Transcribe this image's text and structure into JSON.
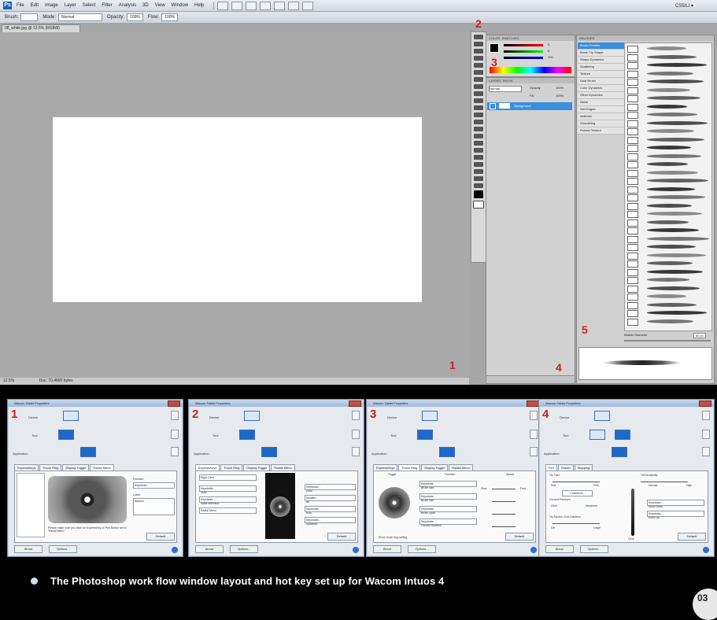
{
  "photoshop": {
    "menu": [
      "File",
      "Edit",
      "Image",
      "Layer",
      "Select",
      "Filter",
      "Analysis",
      "3D",
      "View",
      "Window",
      "Help"
    ],
    "workspace_label": "CS5/LI ▾",
    "options": {
      "brush_label": "Brush:",
      "mode_label": "Mode:",
      "mode_value": "Normal",
      "opacity_label": "Opacity:",
      "opacity_value": "100%",
      "flow_label": "Flow:",
      "flow_value": "100%"
    },
    "doc_tab": "08_white.jpg @ 12.5% (RGB/8)",
    "status_zoom": "12.5%",
    "status_doc": "Doc: 70.4M/0 bytes",
    "color_panel": {
      "tab": "COLOR",
      "swatches_tab": "SWATCHES",
      "r": "0",
      "g": "0",
      "b": "100"
    },
    "layers_panel": {
      "tab": "LAYERS",
      "paths_tab": "PATHS",
      "mode": "Normal",
      "opacity_label": "Opacity:",
      "opacity": "100%",
      "fill_label": "Fill:",
      "fill": "100%",
      "layer_name": "Background"
    },
    "brushes_panel": {
      "tab": "BRUSHES",
      "items": [
        "Brush Presets",
        "Brush Tip Shape",
        "Shape Dynamics",
        "Scattering",
        "Texture",
        "Dual Brush",
        "Color Dynamics",
        "Other Dynamics",
        "Noise",
        "Wet Edges",
        "Airbrush",
        "Smoothing",
        "Protect Texture"
      ],
      "master_diameter_label": "Master Diameter",
      "master_diameter_value": "60 px"
    },
    "annotations": [
      "1",
      "2",
      "3",
      "4",
      "5"
    ]
  },
  "dialogs": [
    {
      "number": "1",
      "title": "Wacom Tablet Properties",
      "labels": {
        "device": "Device",
        "tool": "Tool",
        "application": "Application"
      },
      "tools": [
        "Functions",
        "Grip Pen",
        "Mouse",
        "Classic Pen"
      ],
      "apps": [
        "All Other",
        "Photoshop"
      ],
      "tabs": [
        "ExpressKeys",
        "Touch Ring",
        "Display Toggle",
        "Radial Menu"
      ],
      "function_label": "Function",
      "function_value": "Keystroke...",
      "label_label": "Label:",
      "label_value": "transfor",
      "note": "Please make sure you have an ExpressKey or Pen Button set to 'Radial Menu'",
      "buttons": {
        "about": "About",
        "options": "Options...",
        "default": "Default"
      }
    },
    {
      "number": "2",
      "title": "Wacom Tablet Properties",
      "labels": {
        "device": "Device",
        "tool": "Tool",
        "application": "Application"
      },
      "tools": [
        "Functions",
        "Grip Pen",
        "Mouse",
        "Classic Pen"
      ],
      "apps": [
        "All Other",
        "Photoshop"
      ],
      "tabs": [
        "ExpressKeys",
        "Touch Ring",
        "Display Toggle",
        "Radial Menu"
      ],
      "left_keys": [
        "Right Click",
        "Keystroke...",
        "Keystroke...",
        "Radial Menu"
      ],
      "left_sub": [
        "",
        "undo",
        "make selection",
        ""
      ],
      "right_keys": [
        "Keystroke...",
        "Modifier...",
        "Keystroke...",
        "Keystroke..."
      ],
      "right_sub": [
        "undo",
        "alt",
        "redo",
        "spacebar"
      ],
      "buttons": {
        "about": "About",
        "options": "Options...",
        "default": "Default"
      }
    },
    {
      "number": "3",
      "title": "Wacom Tablet Properties",
      "labels": {
        "device": "Device",
        "tool": "Tool",
        "application": "Application"
      },
      "tools": [
        "Functions",
        "Grip Pen",
        "Mouse",
        "Classic Pen"
      ],
      "apps": [
        "All Other",
        "Photoshop"
      ],
      "tabs": [
        "ExpressKeys",
        "Touch Ring",
        "Display Toggle",
        "Radial Menu"
      ],
      "col_toggle": "Toggle",
      "col_function": "Function",
      "col_speed": "Speed",
      "functions": [
        "Keystroke...",
        "Keystroke...",
        "Keystroke...",
        "Keystroke..."
      ],
      "function_subs": [
        "Brush size",
        "Brush size",
        "Brush cycle",
        "Canvas Rotation"
      ],
      "speed_slow": "Slow",
      "speed_fast": "Fast",
      "checkbox": "Show touch ring setting",
      "buttons": {
        "about": "About",
        "options": "Options...",
        "default": "Default"
      }
    },
    {
      "number": "4",
      "title": "Wacom Tablet Properties",
      "labels": {
        "device": "Device",
        "tool": "Tool",
        "application": "Application"
      },
      "tools": [
        "Functions",
        "Grip Pen",
        "Mouse",
        "Classic Pen"
      ],
      "apps": [
        "All Other",
        "Photoshop"
      ],
      "tabs": [
        "Pen",
        "Eraser",
        "Mapping"
      ],
      "tip_feel": "Tip Feel",
      "soft": "Soft",
      "firm": "Firm",
      "customize": "Customize...",
      "current_pressure": "Current Pressure",
      "click": "Click",
      "maximum": "Maximum",
      "tip_double_click": "Tip Double Click Distance",
      "off": "Off",
      "large": "Large",
      "tilt": "Tilt Sensitivity",
      "normal": "Normal",
      "high": "High",
      "pen_keys": [
        "Keystroke...",
        "Keystroke..."
      ],
      "pen_subs": [
        "brush down",
        "brush up"
      ],
      "pen_click": "Click",
      "buttons": {
        "about": "About",
        "options": "Options...",
        "default": "Default"
      }
    }
  ],
  "caption": "The Photoshop work flow window layout and hot key set up for Wacom Intuos 4",
  "corner_badge": "03"
}
